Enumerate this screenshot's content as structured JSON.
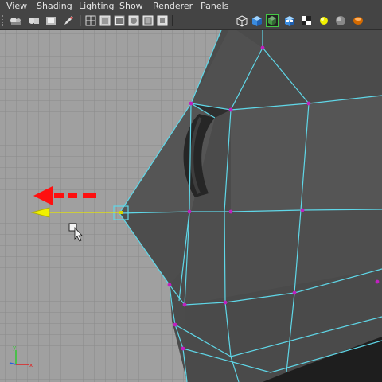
{
  "menu": {
    "items": [
      {
        "label": "View"
      },
      {
        "label": "Shading"
      },
      {
        "label": "Lighting"
      },
      {
        "label": "Show"
      },
      {
        "label": "Renderer"
      },
      {
        "label": "Panels"
      }
    ]
  },
  "toolbar": {
    "icons": [
      "camera-attributes-icon",
      "bookmark-icon",
      "image-plane-icon",
      "pencil-icon",
      "wireframe-icon",
      "smooth-shade-icon",
      "textured-icon",
      "lights-icon",
      "wireframe-on-shaded-icon",
      "xray-icon",
      "cube-wireframe-icon",
      "cube-shaded-icon",
      "cube-texture-icon",
      "checker-icon",
      "light-bulb-icon",
      "sphere-icon",
      "render-icon"
    ]
  },
  "viewport": {
    "axis": {
      "x_label": "x",
      "y_label": "y"
    },
    "colors": {
      "background": "#a0a0a0",
      "grid": "#8a8a8a",
      "mesh_face": "#4a4a4a",
      "edge": "#5fd7e8",
      "vertex": "#c020c0",
      "drag_arrow": "#ff1010",
      "move_handle": "#e6e600"
    }
  }
}
